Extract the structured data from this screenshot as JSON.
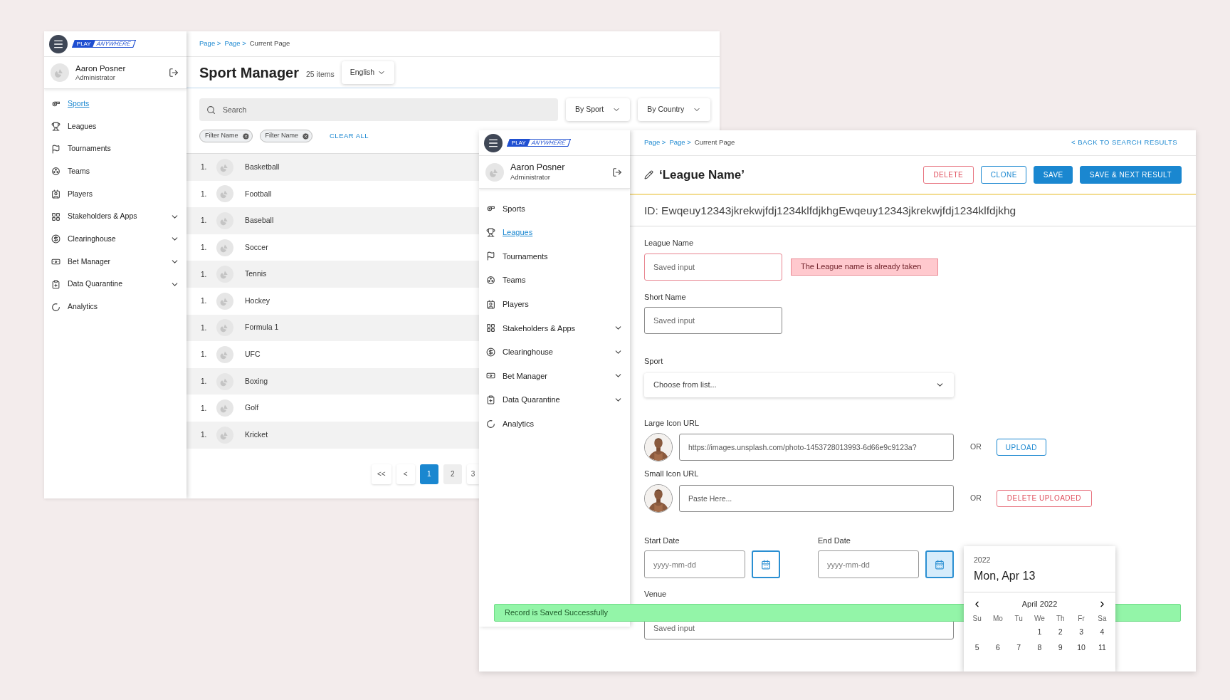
{
  "background_window": {
    "logo": {
      "word_1": "PLAY",
      "word_2": "ANYWHERE"
    },
    "user": {
      "name": "Aaron Posner",
      "role": "Administrator"
    },
    "nav": [
      {
        "label": "Sports",
        "selected": true,
        "has_submenu": false
      },
      {
        "label": "Leagues",
        "selected": false,
        "has_submenu": false
      },
      {
        "label": "Tournaments",
        "selected": false,
        "has_submenu": false
      },
      {
        "label": "Teams",
        "selected": false,
        "has_submenu": false
      },
      {
        "label": "Players",
        "selected": false,
        "has_submenu": false
      },
      {
        "label": "Stakeholders & Apps",
        "selected": false,
        "has_submenu": true
      },
      {
        "label": "Clearinghouse",
        "selected": false,
        "has_submenu": true
      },
      {
        "label": "Bet Manager",
        "selected": false,
        "has_submenu": true
      },
      {
        "label": "Data Quarantine",
        "selected": false,
        "has_submenu": true
      },
      {
        "label": "Analytics",
        "selected": false,
        "has_submenu": false
      }
    ],
    "breadcrumb": [
      {
        "label": "Page >",
        "kind": "link"
      },
      {
        "label": "Page >",
        "kind": "link"
      },
      {
        "label": "Current Page",
        "kind": "current"
      }
    ],
    "title": "Sport Manager",
    "count": "25 items",
    "language": "English",
    "search": {
      "placeholder": "Search"
    },
    "filters": [
      "By Sport",
      "By Country"
    ],
    "chips": [
      "Filter Name",
      "Filter Name"
    ],
    "clear_all": "CLEAR ALL",
    "rows": [
      {
        "number": "1.",
        "name": "Basketball"
      },
      {
        "number": "1.",
        "name": "Football"
      },
      {
        "number": "1.",
        "name": "Baseball"
      },
      {
        "number": "1.",
        "name": "Soccer"
      },
      {
        "number": "1.",
        "name": "Tennis"
      },
      {
        "number": "1.",
        "name": "Hockey"
      },
      {
        "number": "1.",
        "name": "Formula 1"
      },
      {
        "number": "1.",
        "name": "UFC"
      },
      {
        "number": "1.",
        "name": "Boxing"
      },
      {
        "number": "1.",
        "name": "Golf"
      },
      {
        "number": "1.",
        "name": "Kricket"
      }
    ],
    "pagination": [
      {
        "label": "<<",
        "selected": false,
        "hovered": false
      },
      {
        "label": "<",
        "selected": false,
        "hovered": false
      },
      {
        "label": "1",
        "selected": true,
        "hovered": false
      },
      {
        "label": "2",
        "selected": false,
        "hovered": true
      },
      {
        "label": "3",
        "selected": false,
        "hovered": false
      }
    ]
  },
  "front_window": {
    "logo": {
      "word_1": "PLAY",
      "word_2": "ANYWHERE"
    },
    "user": {
      "name": "Aaron Posner",
      "role": "Administrator"
    },
    "nav": [
      {
        "label": "Sports",
        "selected": false,
        "has_submenu": false
      },
      {
        "label": "Leagues",
        "selected": true,
        "has_submenu": false
      },
      {
        "label": "Tournaments",
        "selected": false,
        "has_submenu": false
      },
      {
        "label": "Teams",
        "selected": false,
        "has_submenu": false
      },
      {
        "label": "Players",
        "selected": false,
        "has_submenu": false
      },
      {
        "label": "Stakeholders & Apps",
        "selected": false,
        "has_submenu": true
      },
      {
        "label": "Clearinghouse",
        "selected": false,
        "has_submenu": true
      },
      {
        "label": "Bet Manager",
        "selected": false,
        "has_submenu": true
      },
      {
        "label": "Data Quarantine",
        "selected": false,
        "has_submenu": true
      },
      {
        "label": "Analytics",
        "selected": false,
        "has_submenu": false
      }
    ],
    "breadcrumb": [
      {
        "label": "Page >",
        "kind": "link"
      },
      {
        "label": "Page >",
        "kind": "link"
      },
      {
        "label": "Current Page",
        "kind": "current"
      }
    ],
    "back_link": "< BACK TO SEARCH RESULTS",
    "title": "‘League Name’",
    "actions": [
      {
        "label": "DELETE",
        "kind": "danger"
      },
      {
        "label": "CLONE",
        "kind": "outline"
      },
      {
        "label": "SAVE",
        "kind": "primary"
      },
      {
        "label": "SAVE & NEXT RESULT",
        "kind": "primary"
      }
    ],
    "id_line": "ID: Ewqeuy12343jkrekwjfdj1234klfdjkhgEwqeuy12343jkrekwjfdj1234klfdjkhg",
    "league_name": {
      "label": "League Name",
      "value": "Saved input",
      "error": "The League name is already taken"
    },
    "short_name": {
      "label": "Short Name",
      "value": "Saved input"
    },
    "sport": {
      "label": "Sport",
      "placeholder": "Choose from list..."
    },
    "large_icon": {
      "label": "Large Icon URL",
      "value": "https://images.unsplash.com/photo-1453728013993-6d66e9c9123a?",
      "or": "OR",
      "button": {
        "label": "UPLOAD",
        "kind": "outline"
      }
    },
    "small_icon": {
      "label": "Small Icon URL",
      "placeholder": "Paste Here...",
      "or": "OR",
      "button": {
        "label": "DELETE UPLOADED",
        "kind": "danger"
      }
    },
    "start_date": {
      "label": "Start Date",
      "placeholder": "yyyy-mm-dd",
      "picker_open": false
    },
    "end_date": {
      "label": "End Date",
      "placeholder": "yyyy-mm-dd",
      "picker_open": true
    },
    "venue": {
      "label": "Venue",
      "value": "Saved input"
    },
    "toast": "Record is Saved Successfully",
    "calendar": {
      "year": "2022",
      "date": "Mon, Apr 13",
      "month": "April 2022",
      "weekdays": [
        "Su",
        "Mo",
        "Tu",
        "We",
        "Th",
        "Fr",
        "Sa"
      ],
      "weeks": [
        [
          "1",
          "2",
          "3",
          "4"
        ],
        [
          "5",
          "6",
          "7",
          "8",
          "9",
          "10",
          "11"
        ]
      ]
    }
  }
}
